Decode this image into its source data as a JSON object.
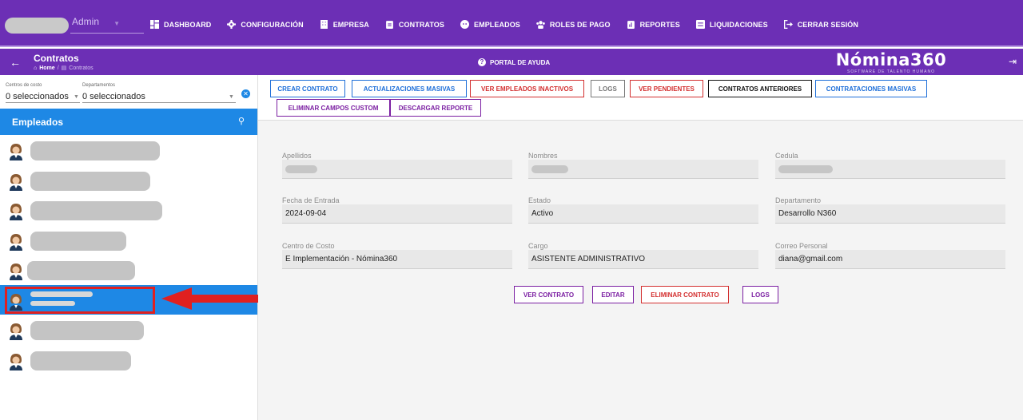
{
  "topnav": {
    "user_role": "Admin",
    "menu": [
      {
        "label": "DASHBOARD",
        "icon": "dashboard-icon"
      },
      {
        "label": "CONFIGURACIÓN",
        "icon": "gear-icon"
      },
      {
        "label": "EMPRESA",
        "icon": "building-icon"
      },
      {
        "label": "CONTRATOS",
        "icon": "clipboard-icon"
      },
      {
        "label": "EMPLEADOS",
        "icon": "face-icon"
      },
      {
        "label": "ROLES DE PAGO",
        "icon": "group-icon"
      },
      {
        "label": "REPORTES",
        "icon": "report-icon"
      },
      {
        "label": "LIQUIDACIONES",
        "icon": "list-icon"
      },
      {
        "label": "CERRAR SESIÓN",
        "icon": "logout-icon"
      }
    ]
  },
  "subbar": {
    "title": "Contratos",
    "breadcrumb_home": "Home",
    "breadcrumb_current": "Contratos",
    "help_label": "PORTAL DE AYUDA",
    "brand_name": "Nómina360",
    "brand_tagline": "SOFTWARE DE TALENTO HUMANO"
  },
  "filters": {
    "cost_center_label": "Centros de costo",
    "cost_center_value": "0 seleccionados",
    "departments_label": "Departamentos",
    "departments_value": "0 seleccionados"
  },
  "employees": {
    "header": "Empleados",
    "selected_index": 5,
    "count": 8
  },
  "toolbar": {
    "buttons": [
      {
        "label": "CREAR CONTRATO",
        "color": "#1e6fd9"
      },
      {
        "label": "ACTUALIZACIONES MASIVAS",
        "color": "#1e6fd9"
      },
      {
        "label": "VER EMPLEADOS INACTIVOS",
        "color": "#d32f2f"
      },
      {
        "label": "LOGS",
        "color": "#777777"
      },
      {
        "label": "VER PENDIENTES",
        "color": "#d32f2f"
      },
      {
        "label": "CONTRATOS ANTERIORES",
        "color": "#111111"
      },
      {
        "label": "CONTRATACIONES MASIVAS",
        "color": "#1e6fd9"
      },
      {
        "label": "ELIMINAR CAMPOS CUSTOM",
        "color": "#7b1fa2"
      },
      {
        "label": "DESCARGAR REPORTE",
        "color": "#7b1fa2"
      }
    ]
  },
  "contract": {
    "apellidos_label": "Apellidos",
    "nombres_label": "Nombres",
    "cedula_label": "Cedula",
    "fecha_label": "Fecha de Entrada",
    "fecha_value": "2024-09-04",
    "estado_label": "Estado",
    "estado_value": "Activo",
    "departamento_label": "Departamento",
    "departamento_value": "Desarrollo N360",
    "centro_label": "Centro de Costo",
    "centro_value": "E Implementación - Nómina360",
    "cargo_label": "Cargo",
    "cargo_value": "ASISTENTE ADMINISTRATIVO",
    "correo_label": "Correo Personal",
    "correo_value": "diana@gmail.com"
  },
  "actions": {
    "ver_contrato": "VER CONTRATO",
    "editar": "EDITAR",
    "eliminar": "ELIMINAR CONTRATO",
    "logs": "LOGS"
  },
  "colors": {
    "brand_purple": "#6c2fb5",
    "accent_blue": "#1e88e5",
    "highlight_red": "#e02020"
  }
}
